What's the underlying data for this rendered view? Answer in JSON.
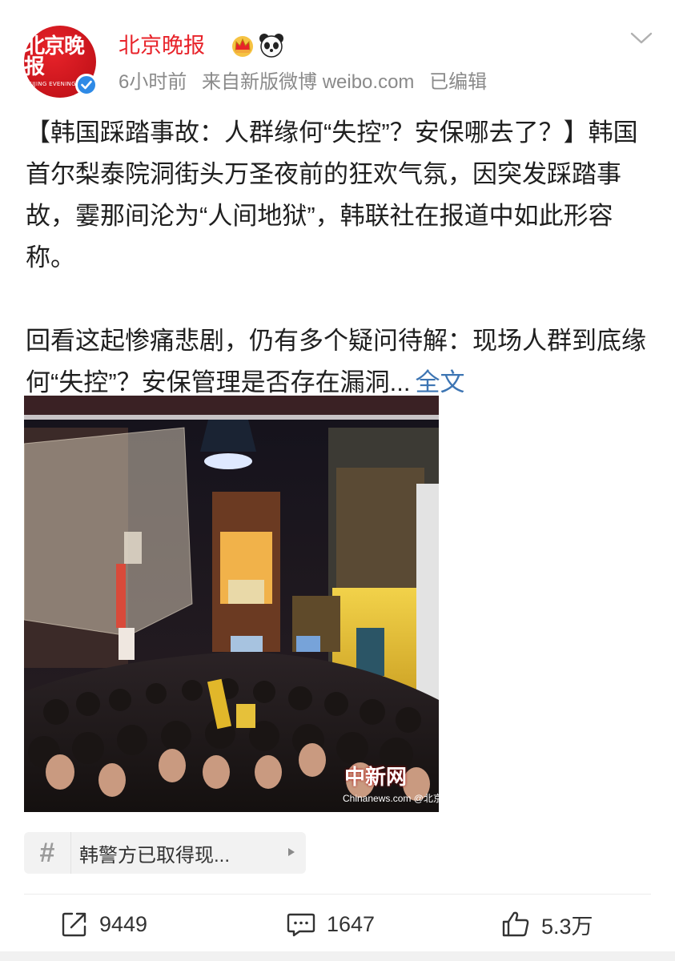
{
  "header": {
    "avatar_cn": "北京晚报",
    "avatar_en": "BEIJING EVENING NEWS",
    "account_name": "北京晚报",
    "time": "6小时前",
    "source": "来自新版微博 weibo.com",
    "edited": "已编辑"
  },
  "post": {
    "paragraph1": "【韩国踩踏事故：人群缘何“失控”？安保哪去了？】韩国首尔梨泰院洞街头万圣夜前的狂欢气氛，因突发踩踏事故，霎那间沦为“人间地狱”，韩联社在报道中如此形容称。",
    "paragraph2": "回看这起惨痛悲剧，仍有多个疑问待解：现场人群到底缘何“失控”？安保管理是否存在漏洞...",
    "more_link": "全文"
  },
  "image": {
    "watermark": "中新网",
    "watermark_sub": "Chinanews.com @北京晚报"
  },
  "topic": {
    "hash": "#",
    "text": "韩警方已取得现..."
  },
  "actions": {
    "repost_count": "9449",
    "comment_count": "1647",
    "like_count": "5.3万"
  },
  "colors": {
    "brand_red": "#e8232a",
    "link_blue": "#3d75b3",
    "verified_blue": "#2e8ae6",
    "meta_gray": "#8a8a8a"
  },
  "icons": [
    "verified-icon",
    "crown-badge-icon",
    "panda-badge-icon",
    "chevron-down-icon",
    "repost-icon",
    "comment-icon",
    "like-icon"
  ]
}
